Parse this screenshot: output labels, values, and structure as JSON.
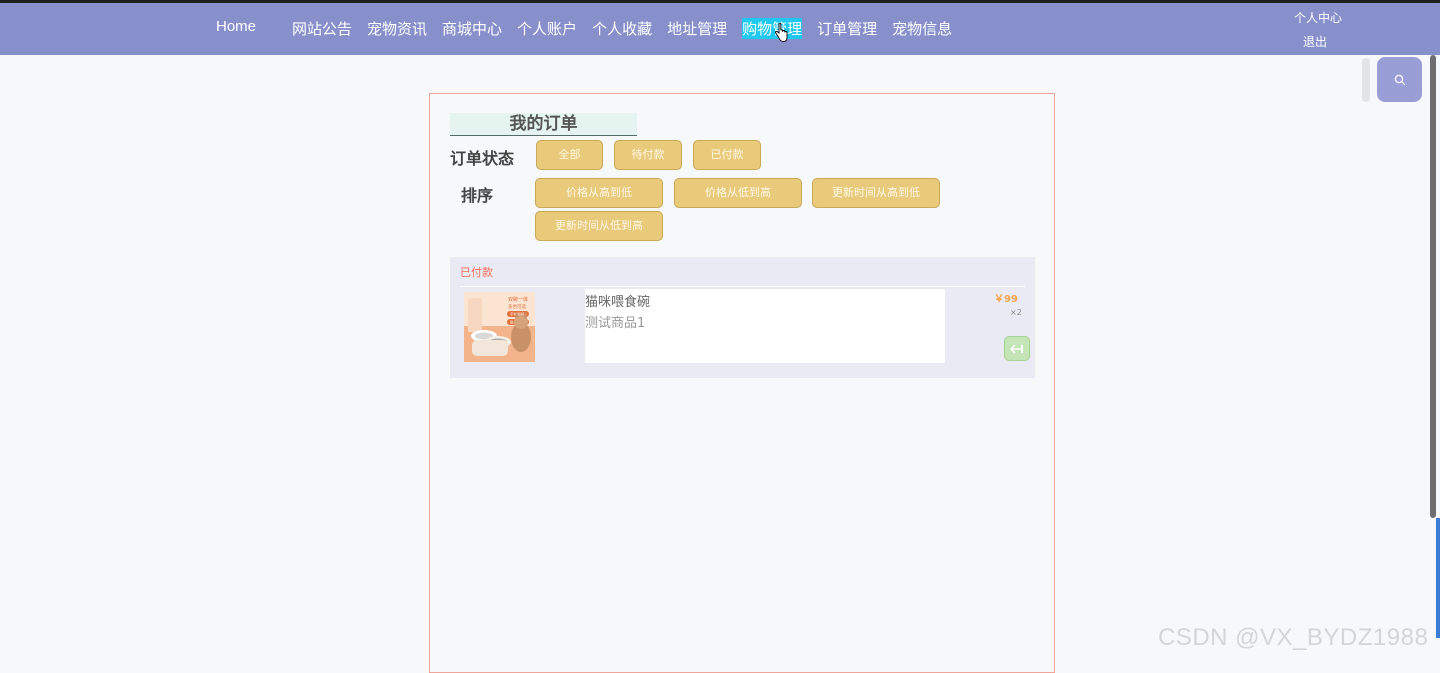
{
  "nav": {
    "home": "Home",
    "items": [
      "网站公告",
      "宠物资讯",
      "商城中心",
      "个人账户",
      "个人收藏",
      "地址管理",
      "购物管理",
      "订单管理",
      "宠物信息"
    ],
    "active_index": 6,
    "user_center": "个人中心",
    "logout": "退出"
  },
  "page": {
    "title": "我的订单",
    "status_label": "订单状态",
    "status_filters": [
      "全部",
      "待付款",
      "已付款"
    ],
    "sort_label": "排序",
    "sort_options": [
      "价格从高到低",
      "价格从低到高",
      "更新时间从高到低",
      "更新时间从低到高"
    ]
  },
  "order": {
    "status": "已付款",
    "product_name": "猫咪喂食碗",
    "product_desc": "测试商品1",
    "price": "￥99",
    "quantity": "×2",
    "image_texts": [
      "双碗一体",
      "多色可选",
      "不锈钢碗",
      "防打翻"
    ]
  },
  "watermark": "CSDN @VX_BYDZ1988",
  "colors": {
    "topbar": "#8790cb",
    "active_nav": "#1ec8ee",
    "button": "#e8ca7a",
    "status_paid": "#f26d5b",
    "price": "#f5a54d",
    "panel_border": "#f0a59b"
  }
}
